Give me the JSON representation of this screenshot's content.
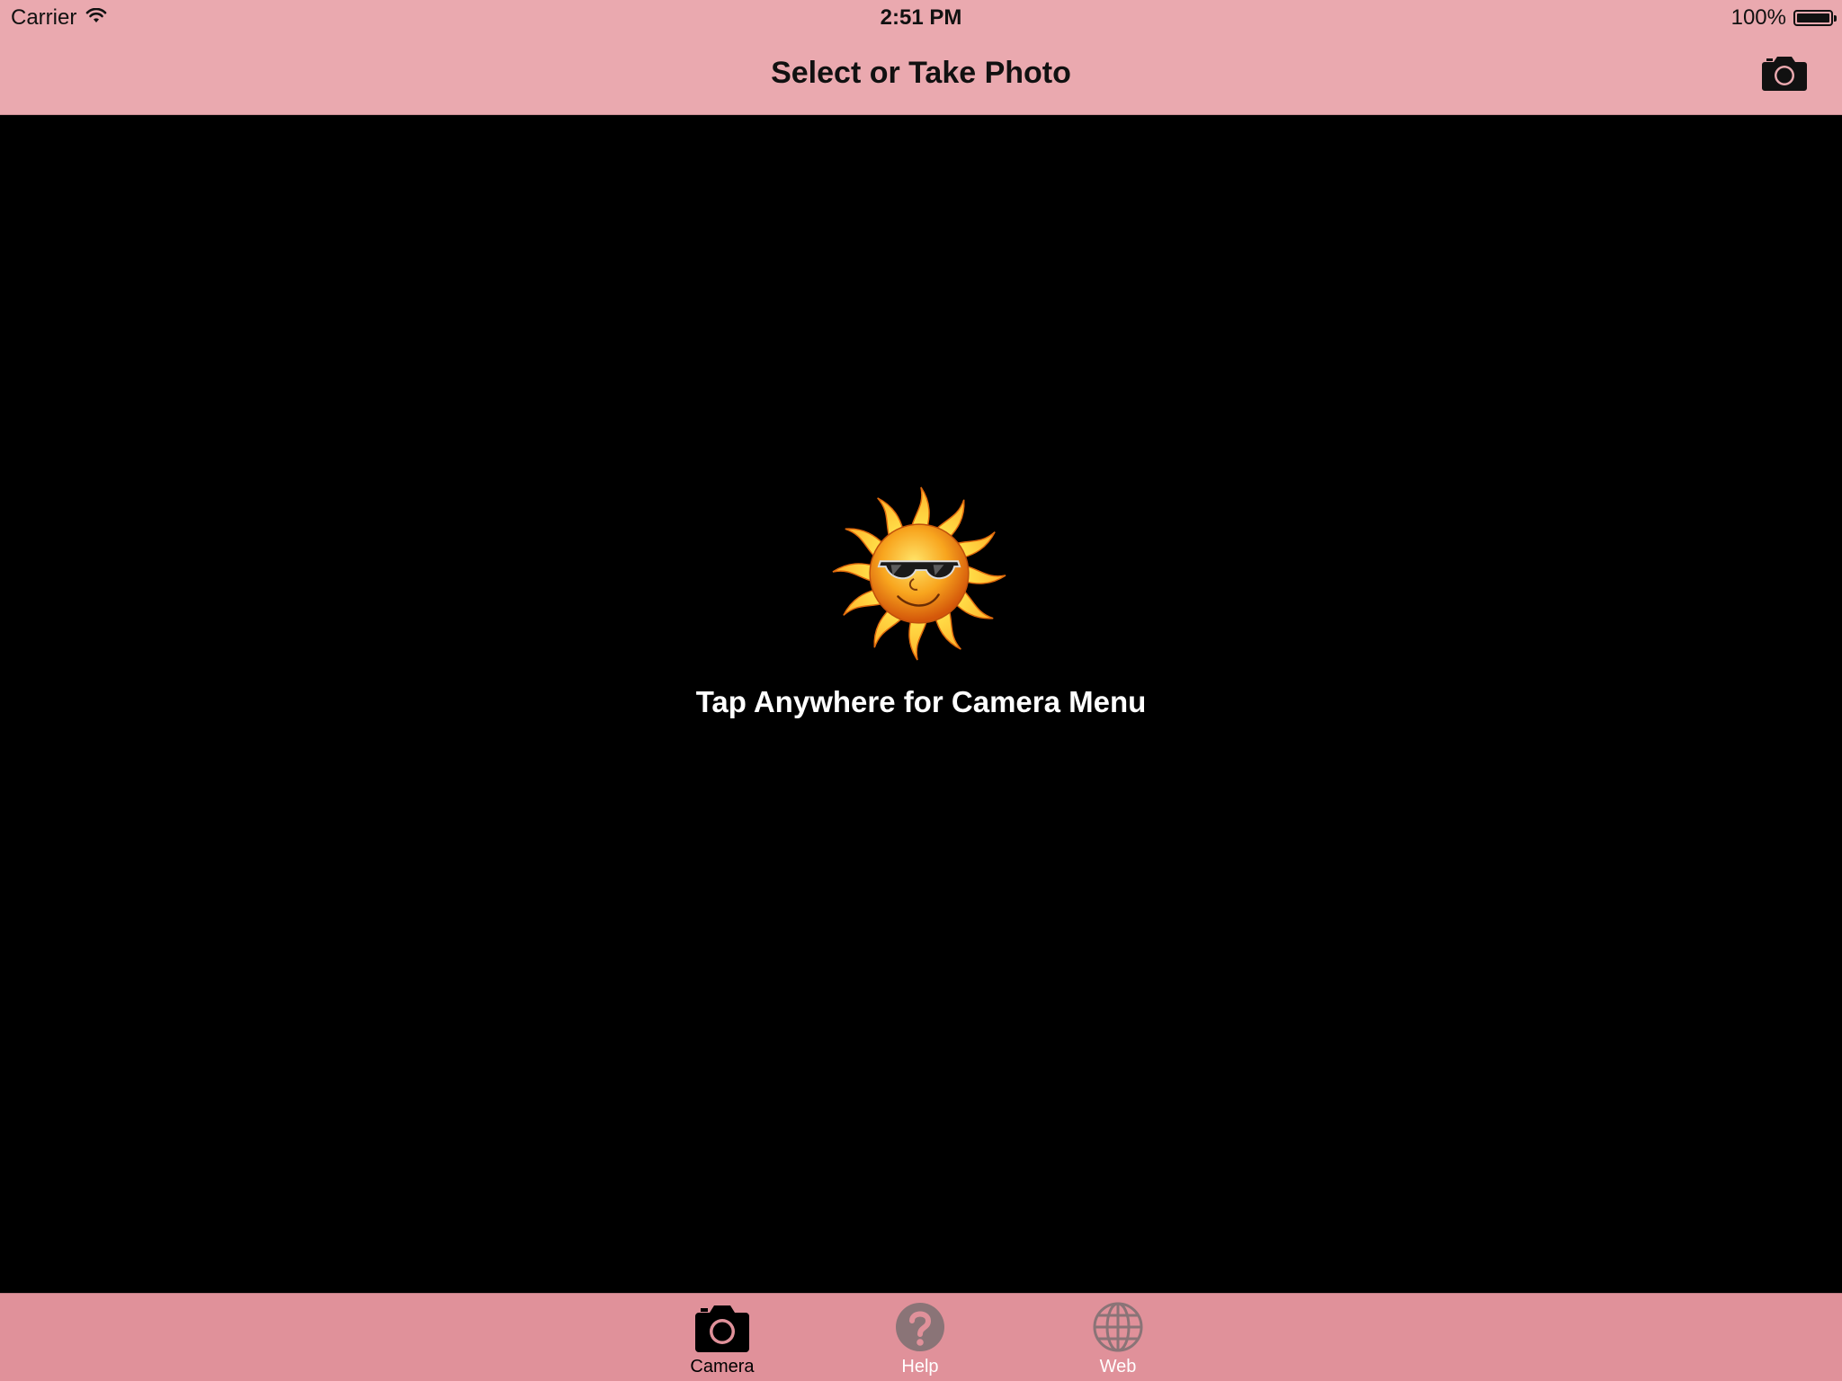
{
  "status_bar": {
    "carrier": "Carrier",
    "time": "2:51 PM",
    "battery": "100%",
    "wifi_icon": "wifi-icon",
    "battery_icon": "battery-icon"
  },
  "nav_bar": {
    "title": "Select or Take Photo",
    "right_icon": "camera-icon"
  },
  "content": {
    "image": "sun-with-sunglasses",
    "hint": "Tap Anywhere for Camera Menu"
  },
  "tab_bar": {
    "tabs": [
      {
        "label": "Camera",
        "icon": "camera-icon",
        "selected": true
      },
      {
        "label": "Help",
        "icon": "question-mark-icon",
        "selected": false
      },
      {
        "label": "Web",
        "icon": "globe-icon",
        "selected": false
      }
    ]
  },
  "colors": {
    "top_bar": "#eaa9af",
    "tab_bar": "#e0919a",
    "content_bg": "#000000",
    "selected_tab": "#000000",
    "unselected_icon": "#8a7477",
    "sun_yellow": "#ffd23a",
    "sun_orange": "#f08a14"
  }
}
